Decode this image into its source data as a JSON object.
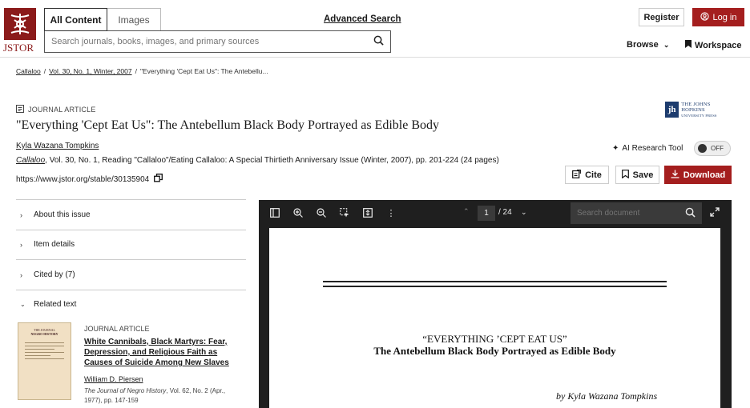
{
  "brand": {
    "name": "JSTOR",
    "color": "#a41e1e"
  },
  "header": {
    "tabs": [
      {
        "label": "All Content"
      },
      {
        "label": "Images"
      }
    ],
    "advanced_search": "Advanced Search",
    "search_placeholder": "Search journals, books, images, and primary sources",
    "register": "Register",
    "login": "Log in",
    "browse": "Browse",
    "workspace": "Workspace"
  },
  "breadcrumb": [
    "Callaloo",
    "Vol. 30, No. 1, Winter, 2007",
    "\"Everything 'Cept Eat Us\": The Antebellu..."
  ],
  "article": {
    "type": "JOURNAL ARTICLE",
    "title": "\"Everything 'Cept Eat Us\": The Antebellum Black Body Portrayed as Edible Body",
    "author": "Kyla Wazana Tompkins",
    "journal": "Callaloo",
    "source_rest": ", Vol. 30, No. 1, Reading \"Callaloo\"/Eating Callaloo: A Special Thirtieth Anniversary Issue (Winter, 2007), pp. 201-224 (24 pages)",
    "stable_url": "https://www.jstor.org/stable/30135904",
    "publisher_line1": "THE JOHNS HOPKINS",
    "publisher_line2": "UNIVERSITY PRESS",
    "publisher_mark": "jh"
  },
  "tools": {
    "ai_label": "AI Research Tool",
    "ai_state": "OFF",
    "cite": "Cite",
    "save": "Save",
    "download": "Download"
  },
  "sidebar": {
    "items": [
      {
        "label": "About this issue"
      },
      {
        "label": "Item details"
      },
      {
        "label": "Cited by (7)"
      },
      {
        "label": "Related text"
      }
    ],
    "related": {
      "type": "JOURNAL ARTICLE",
      "title": "White Cannibals, Black Martyrs: Fear, Depression, and Religious Faith as Causes of Suicide Among New Slaves",
      "author": "William D. Piersen",
      "journal": "The Journal of Negro History",
      "source_rest": ", Vol. 62, No. 2 (Apr., 1977), pp. 147-159",
      "thumb_line1": "THE JOURNAL",
      "thumb_line2": "NEGRO HISTORY"
    }
  },
  "viewer": {
    "page_current": "1",
    "page_total": "/ 24",
    "search_placeholder": "Search document",
    "pdf_title_line1": "“EVERYTHING ’CEPT EAT US”",
    "pdf_title_line2": "The Antebellum Black Body Portrayed as Edible Body",
    "pdf_byline": "by Kyla Wazana Tompkins"
  }
}
